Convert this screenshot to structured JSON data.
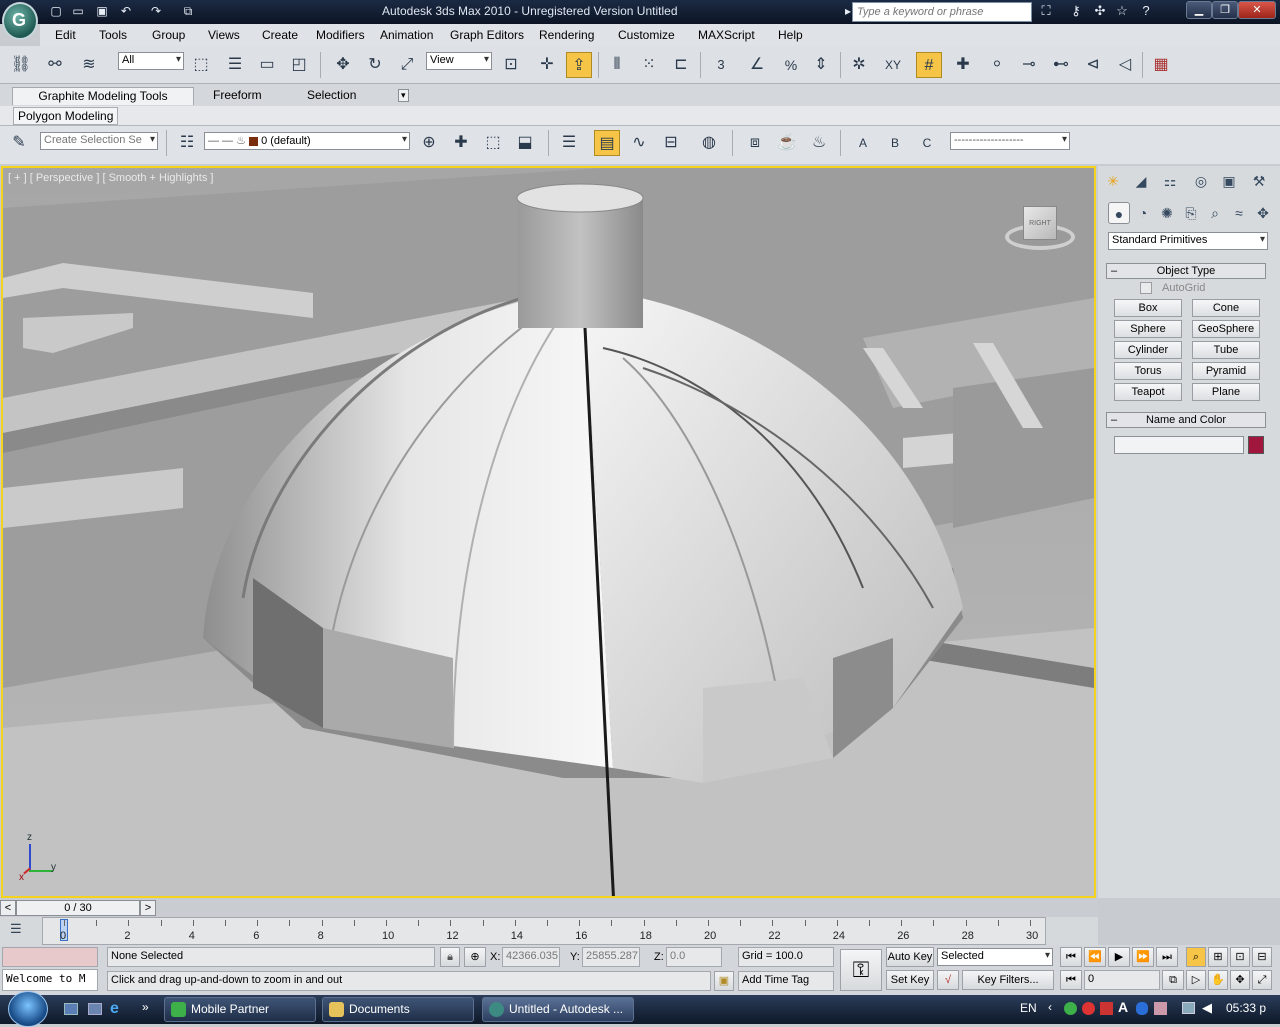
{
  "titlebar": {
    "title": "Autodesk 3ds Max  2010   - Unregistered Version     Untitled",
    "search_placeholder": "Type a keyword or phrase",
    "minimize": "▁",
    "restore": "❐",
    "close": "✕"
  },
  "menubar": {
    "items": [
      "Edit",
      "Tools",
      "Group",
      "Views",
      "Create",
      "Modifiers",
      "Animation",
      "Graph Editors",
      "Rendering",
      "Customize",
      "MAXScript",
      "Help"
    ]
  },
  "toolbar": {
    "selection_filter": "All",
    "reference_coord": "View",
    "snap_labels": {
      "angle": "3",
      "percent": "%",
      "xy": "XY"
    }
  },
  "ribbon": {
    "tabs": [
      "Graphite Modeling Tools",
      "Freeform",
      "Selection"
    ],
    "active_tab": "Graphite Modeling Tools",
    "sub_label": "Polygon Modeling",
    "named_selection": "Create Selection Se",
    "layer": "0 (default)",
    "selection_letters": {
      "a": "A",
      "b": "B",
      "c": "C"
    }
  },
  "viewport": {
    "label": "[ + ] [ Perspective ] [ Smooth + Highlights ]",
    "viewcube_face": "RIGHT",
    "axes": {
      "x": "x",
      "y": "y",
      "z": "z"
    }
  },
  "command_panel": {
    "category_dropdown": "Standard Primitives",
    "object_type_header": "Object Type",
    "autogrid": "AutoGrid",
    "buttons": [
      "Box",
      "Cone",
      "Sphere",
      "GeoSphere",
      "Cylinder",
      "Tube",
      "Torus",
      "Pyramid",
      "Teapot",
      "Plane"
    ],
    "name_color_header": "Name and Color",
    "name_value": "",
    "object_color": "#a0163c",
    "collapse_sign": "–"
  },
  "timeline": {
    "frame_display": "0 / 30",
    "prev_arrow": "<",
    "next_arrow": ">",
    "frame_labels": [
      "0",
      "2",
      "4",
      "6",
      "8",
      "10",
      "12",
      "14",
      "16",
      "18",
      "20",
      "22",
      "24",
      "26",
      "28",
      "30"
    ]
  },
  "statusbar": {
    "selection_status": "None Selected",
    "prompt": "Click and drag up-and-down to zoom in and out",
    "maxscript_listener": "Welcome to M",
    "x_label": "X:",
    "x_value": "42366.035",
    "y_label": "Y:",
    "y_value": "25855.287",
    "z_label": "Z:",
    "z_value": "0.0",
    "grid": "Grid = 100.0",
    "add_time_tag": "Add Time Tag",
    "auto_key": "Auto Key",
    "set_key": "Set Key",
    "key_mode_select": "Selected",
    "key_filters": "Key Filters...",
    "current_frame": "0"
  },
  "taskbar": {
    "buttons": [
      "Mobile Partner",
      "Documents",
      "Untitled - Autodesk ..."
    ],
    "language": "EN",
    "clock": "05:33 р"
  },
  "colors": {
    "viewport_border": "#f3d31c",
    "active_tool": "#f6c447",
    "titlebar": "#1b2a44"
  }
}
